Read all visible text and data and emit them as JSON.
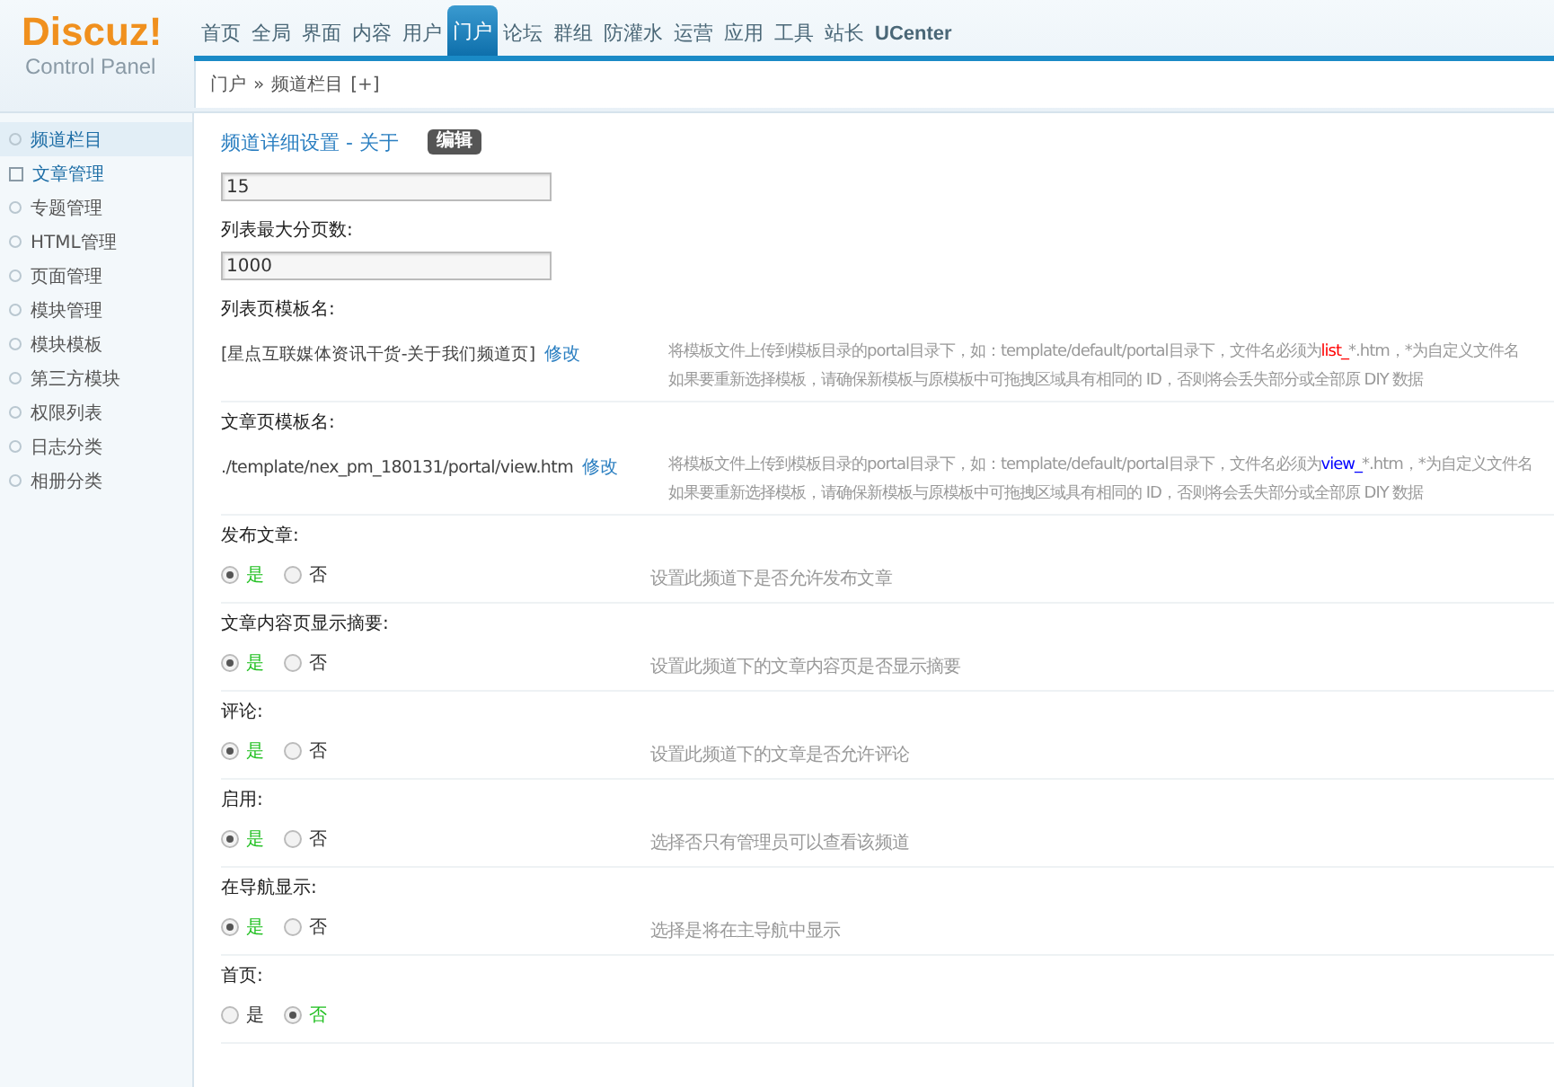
{
  "logo": {
    "title": "Discuz!",
    "subtitle": "Control Panel"
  },
  "nav": [
    {
      "label": "首页",
      "selected": false
    },
    {
      "label": "全局",
      "selected": false
    },
    {
      "label": "界面",
      "selected": false
    },
    {
      "label": "内容",
      "selected": false
    },
    {
      "label": "用户",
      "selected": false
    },
    {
      "label": "门户",
      "selected": true
    },
    {
      "label": "论坛",
      "selected": false
    },
    {
      "label": "群组",
      "selected": false
    },
    {
      "label": "防灌水",
      "selected": false
    },
    {
      "label": "运营",
      "selected": false
    },
    {
      "label": "应用",
      "selected": false
    },
    {
      "label": "工具",
      "selected": false
    },
    {
      "label": "站长",
      "selected": false
    },
    {
      "label": "UCenter",
      "selected": false
    }
  ],
  "breadcrumb": [
    "门户",
    "»",
    "频道栏目",
    "[+]"
  ],
  "sidebar": {
    "items": [
      {
        "label": "频道栏目",
        "kind": "circle",
        "selected": true
      },
      {
        "label": "文章管理",
        "kind": "square",
        "selected": false
      },
      {
        "label": "专题管理",
        "kind": "circle",
        "selected": false
      },
      {
        "label": "HTML管理",
        "kind": "circle",
        "selected": false
      },
      {
        "label": "页面管理",
        "kind": "circle",
        "selected": false
      },
      {
        "label": "模块管理",
        "kind": "circle",
        "selected": false
      },
      {
        "label": "模块模板",
        "kind": "circle",
        "selected": false
      },
      {
        "label": "第三方模块",
        "kind": "circle",
        "selected": false
      },
      {
        "label": "权限列表",
        "kind": "circle",
        "selected": false
      },
      {
        "label": "日志分类",
        "kind": "circle",
        "selected": false
      },
      {
        "label": "相册分类",
        "kind": "circle",
        "selected": false
      }
    ]
  },
  "heading": {
    "title": "频道详细设置 - 关于",
    "badge": "编辑"
  },
  "settings": [
    {
      "kind": "input",
      "value": "15"
    },
    {
      "kind": "input",
      "label": "列表最大分页数:",
      "value": "1000"
    },
    {
      "kind": "template",
      "label": "列表页模板名:",
      "value": "[星点互联媒体资讯干货-关于我们频道页]",
      "link": "修改",
      "hint": {
        "before": "将模板文件上传到模板目录的portal目录下，如：template/default/portal目录下，文件名必须为",
        "highlight": "list_",
        "color": "#ff0000",
        "after": "*.htm，*为自定义文件名",
        "line2": "如果要重新选择模板，请确保新模板与原模板中可拖拽区域具有相同的 ID，否则将会丢失部分或全部原 DIY 数据"
      }
    },
    {
      "kind": "template",
      "label": "文章页模板名:",
      "value": "./template/nex_pm_180131/portal/view.htm",
      "link": "修改",
      "hint": {
        "before": "将模板文件上传到模板目录的portal目录下，如：template/default/portal目录下，文件名必须为",
        "highlight": "view_",
        "color": "#0000ff",
        "after": "*.htm，*为自定义文件名",
        "line2": "如果要重新选择模板，请确保新模板与原模板中可拖拽区域具有相同的 ID，否则将会丢失部分或全部原 DIY 数据"
      }
    },
    {
      "kind": "radio",
      "label": "发布文章:",
      "options": [
        {
          "label": "是",
          "selected": true
        },
        {
          "label": "否",
          "selected": false
        }
      ],
      "hint_text": "设置此频道下是否允许发布文章"
    },
    {
      "kind": "radio",
      "label": "文章内容页显示摘要:",
      "options": [
        {
          "label": "是",
          "selected": true
        },
        {
          "label": "否",
          "selected": false
        }
      ],
      "hint_text": "设置此频道下的文章内容页是否显示摘要"
    },
    {
      "kind": "radio",
      "label": "评论:",
      "options": [
        {
          "label": "是",
          "selected": true
        },
        {
          "label": "否",
          "selected": false
        }
      ],
      "hint_text": "设置此频道下的文章是否允许评论"
    },
    {
      "kind": "radio",
      "label": "启用:",
      "options": [
        {
          "label": "是",
          "selected": true
        },
        {
          "label": "否",
          "selected": false
        }
      ],
      "hint_text": "选择否只有管理员可以查看该频道"
    },
    {
      "kind": "radio",
      "label": "在导航显示:",
      "options": [
        {
          "label": "是",
          "selected": true
        },
        {
          "label": "否",
          "selected": false
        }
      ],
      "hint_text": "选择是将在主导航中显示"
    },
    {
      "kind": "radio",
      "label": "首页:",
      "options": [
        {
          "label": "是",
          "selected": false
        },
        {
          "label": "否",
          "selected": true
        }
      ]
    }
  ]
}
